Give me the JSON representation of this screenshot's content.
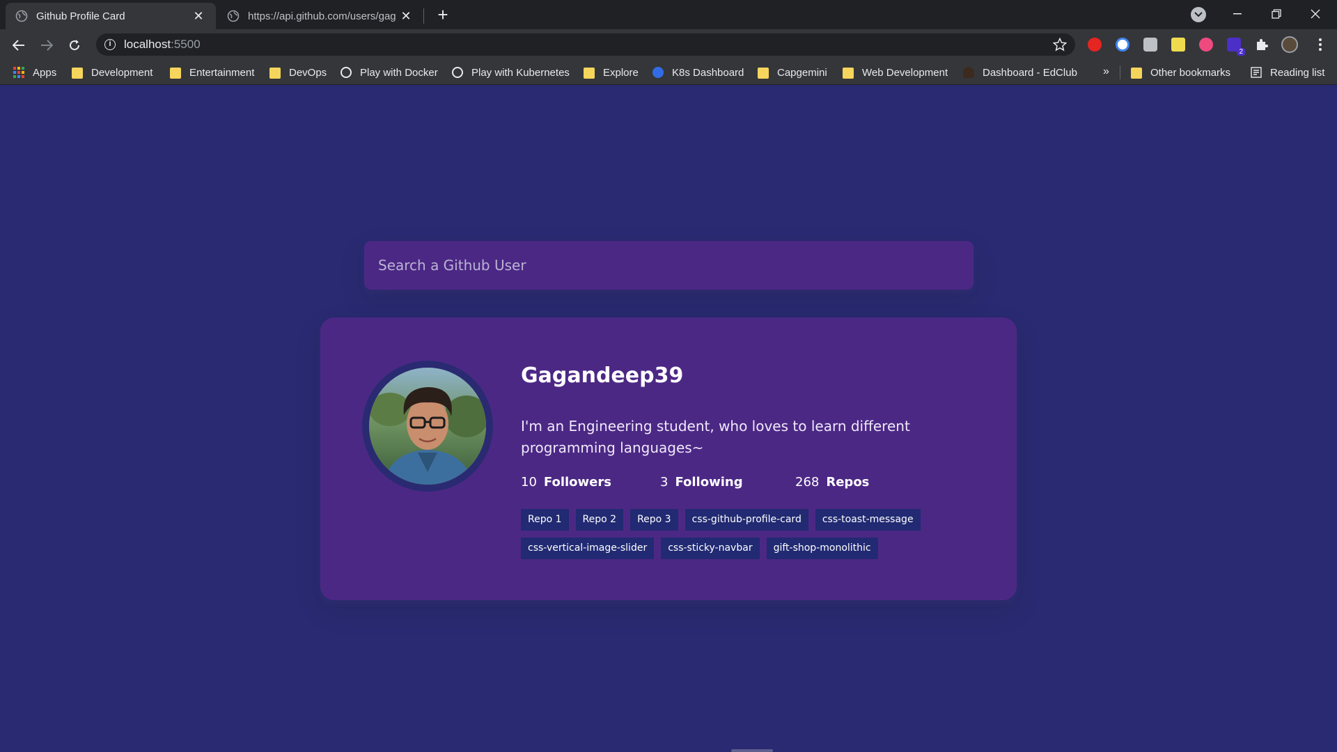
{
  "browser": {
    "tabs": [
      {
        "title": "Github Profile Card",
        "active": true
      },
      {
        "title": "https://api.github.com/users/gag",
        "active": false
      }
    ],
    "new_tab_label": "+",
    "url_host": "localhost",
    "url_port": ":5500",
    "bookmarks": [
      {
        "label": "Apps",
        "icon": "apps-grid-icon"
      },
      {
        "label": "Development",
        "icon": "folder-icon"
      },
      {
        "label": "Entertainment",
        "icon": "folder-icon"
      },
      {
        "label": "DevOps",
        "icon": "folder-icon"
      },
      {
        "label": "Play with Docker",
        "icon": "globe-icon"
      },
      {
        "label": "Play with Kubernetes",
        "icon": "globe-icon"
      },
      {
        "label": "Explore",
        "icon": "folder-icon"
      },
      {
        "label": "K8s Dashboard",
        "icon": "kubernetes-icon"
      },
      {
        "label": "Capgemini",
        "icon": "folder-icon"
      },
      {
        "label": "Web Development",
        "icon": "folder-icon"
      },
      {
        "label": "Dashboard - EdClub",
        "icon": "edclub-icon"
      }
    ],
    "more_bookmarks": "»",
    "other_bookmarks": "Other bookmarks",
    "reading_list": "Reading list",
    "extension_badge": "2"
  },
  "search": {
    "placeholder": "Search a Github User",
    "value": ""
  },
  "profile": {
    "username": "Gagandeep39",
    "bio": "I'm an Engineering student, who loves to learn different programming languages~",
    "followers_count": "10",
    "followers_label": "Followers",
    "following_count": "3",
    "following_label": "Following",
    "repos_count": "268",
    "repos_label": "Repos",
    "repos": [
      "Repo 1",
      "Repo 2",
      "Repo 3",
      "css-github-profile-card",
      "css-toast-message",
      "css-vertical-image-slider",
      "css-sticky-navbar",
      "gift-shop-monolithic"
    ]
  },
  "colors": {
    "page_background": "#2a2a72",
    "card_background": "#4c2885",
    "repo_chip": "#212a72",
    "bookmark_folder": "#f6d55c"
  }
}
